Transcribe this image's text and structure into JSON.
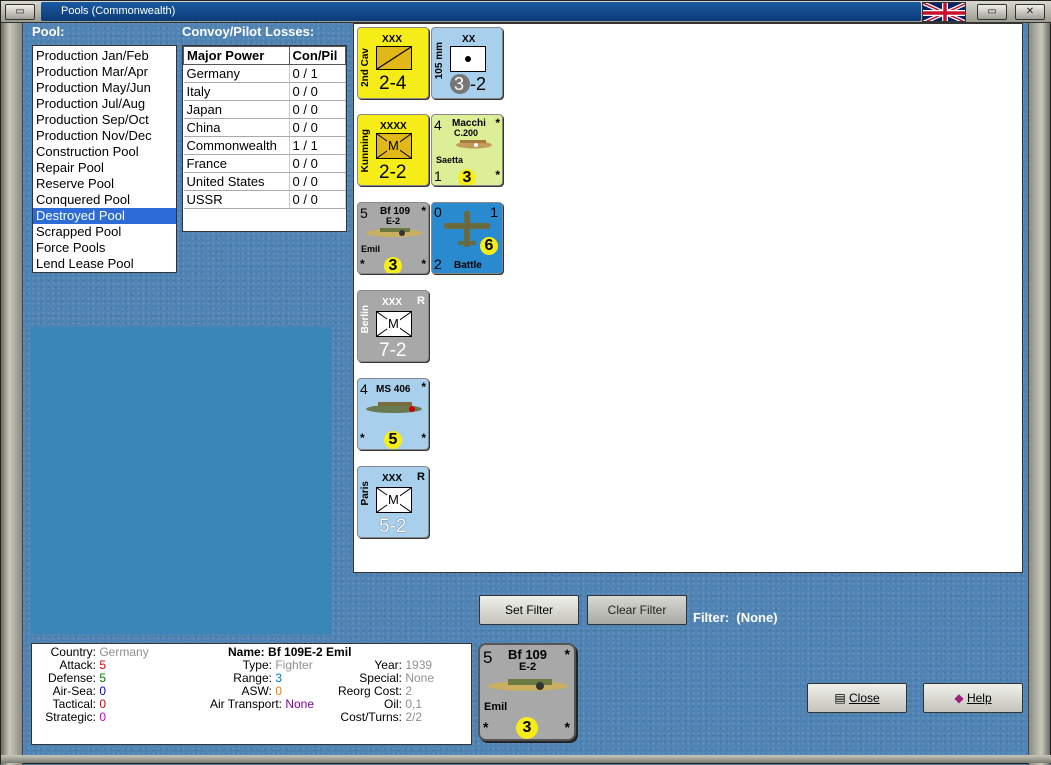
{
  "window": {
    "title": "Pools (Commonwealth)"
  },
  "pool_label": "Pool:",
  "losses_label": "Convoy/Pilot Losses:",
  "pools": [
    "Production Jan/Feb",
    "Production Mar/Apr",
    "Production May/Jun",
    "Production Jul/Aug",
    "Production Sep/Oct",
    "Production Nov/Dec",
    "Construction Pool",
    "Repair Pool",
    "Reserve Pool",
    "Conquered Pool",
    "Destroyed Pool",
    "Scrapped Pool",
    "Force Pools",
    "Lend Lease Pool"
  ],
  "selected_pool": "Destroyed Pool",
  "losses": {
    "headers": [
      "Major Power",
      "Con/Pil"
    ],
    "rows": [
      [
        "Germany",
        "0 / 1"
      ],
      [
        "Italy",
        "0 / 0"
      ],
      [
        "Japan",
        "0 / 0"
      ],
      [
        "China",
        "0 / 0"
      ],
      [
        "Commonwealth",
        "1 / 1"
      ],
      [
        "France",
        "0 / 0"
      ],
      [
        "United States",
        "0 / 0"
      ],
      [
        "USSR",
        "0 / 0"
      ]
    ]
  },
  "counters": {
    "cav": {
      "name": "2nd Cav",
      "size": "XXX",
      "value": "2-4"
    },
    "art": {
      "name": "105 mm",
      "size": "XX",
      "left": "3",
      "right": "2"
    },
    "kunming": {
      "name": "Kunming",
      "size": "XXXX",
      "letter": "M",
      "value": "2-2"
    },
    "macchi": {
      "tl": "4",
      "name": "Macchi",
      "model": "C.200",
      "sub": "Saetta",
      "bl": "1",
      "range": "3",
      "star": "*"
    },
    "bf109": {
      "tl": "5",
      "name": "Bf 109",
      "model": "E-2",
      "sub": "Emil",
      "range": "3",
      "star": "*"
    },
    "battle": {
      "tl": "0",
      "tr": "1",
      "bl": "2",
      "range": "6",
      "name": "Battle"
    },
    "berlin": {
      "name": "Berlin",
      "size": "XXX",
      "corner": "R",
      "letter": "M",
      "value": "7-2"
    },
    "ms406": {
      "tl": "4",
      "name": "MS 406",
      "range": "5",
      "star": "*"
    },
    "paris": {
      "name": "Paris",
      "size": "XXX",
      "corner": "R",
      "letter": "M",
      "value": "5-2"
    }
  },
  "buttons": {
    "set_filter": "Set Filter",
    "clear_filter": "Clear Filter",
    "close": "Close",
    "help": "Help"
  },
  "filter": {
    "label": "Filter:",
    "value": "(None)"
  },
  "info": {
    "country_k": "Country:",
    "country_v": "Germany",
    "attack_k": "Attack:",
    "attack_v": "5",
    "defense_k": "Defense:",
    "defense_v": "5",
    "airsea_k": "Air-Sea:",
    "airsea_v": "0",
    "tactical_k": "Tactical:",
    "tactical_v": "0",
    "strategic_k": "Strategic:",
    "strategic_v": "0",
    "name_k": "Name:",
    "name_v": "Bf 109E-2 Emil",
    "type_k": "Type:",
    "type_v": "Fighter",
    "range_k": "Range:",
    "range_v": "3",
    "asw_k": "ASW:",
    "asw_v": "0",
    "airtrans_k": "Air Transport:",
    "airtrans_v": "None",
    "year_k": "Year:",
    "year_v": "1939",
    "special_k": "Special:",
    "special_v": "None",
    "reorg_k": "Reorg Cost:",
    "reorg_v": "2",
    "oil_k": "Oil:",
    "oil_v": "0,1",
    "cost_k": "Cost/Turns:",
    "cost_v": "2/2"
  },
  "colors": {
    "attack": "#e00000",
    "defense": "#008000",
    "airsea": "#0000c0",
    "tactical": "#c00000",
    "strategic": "#d000d0",
    "range": "#0080c0",
    "asw": "#e08000",
    "airtrans": "#8000a0"
  }
}
